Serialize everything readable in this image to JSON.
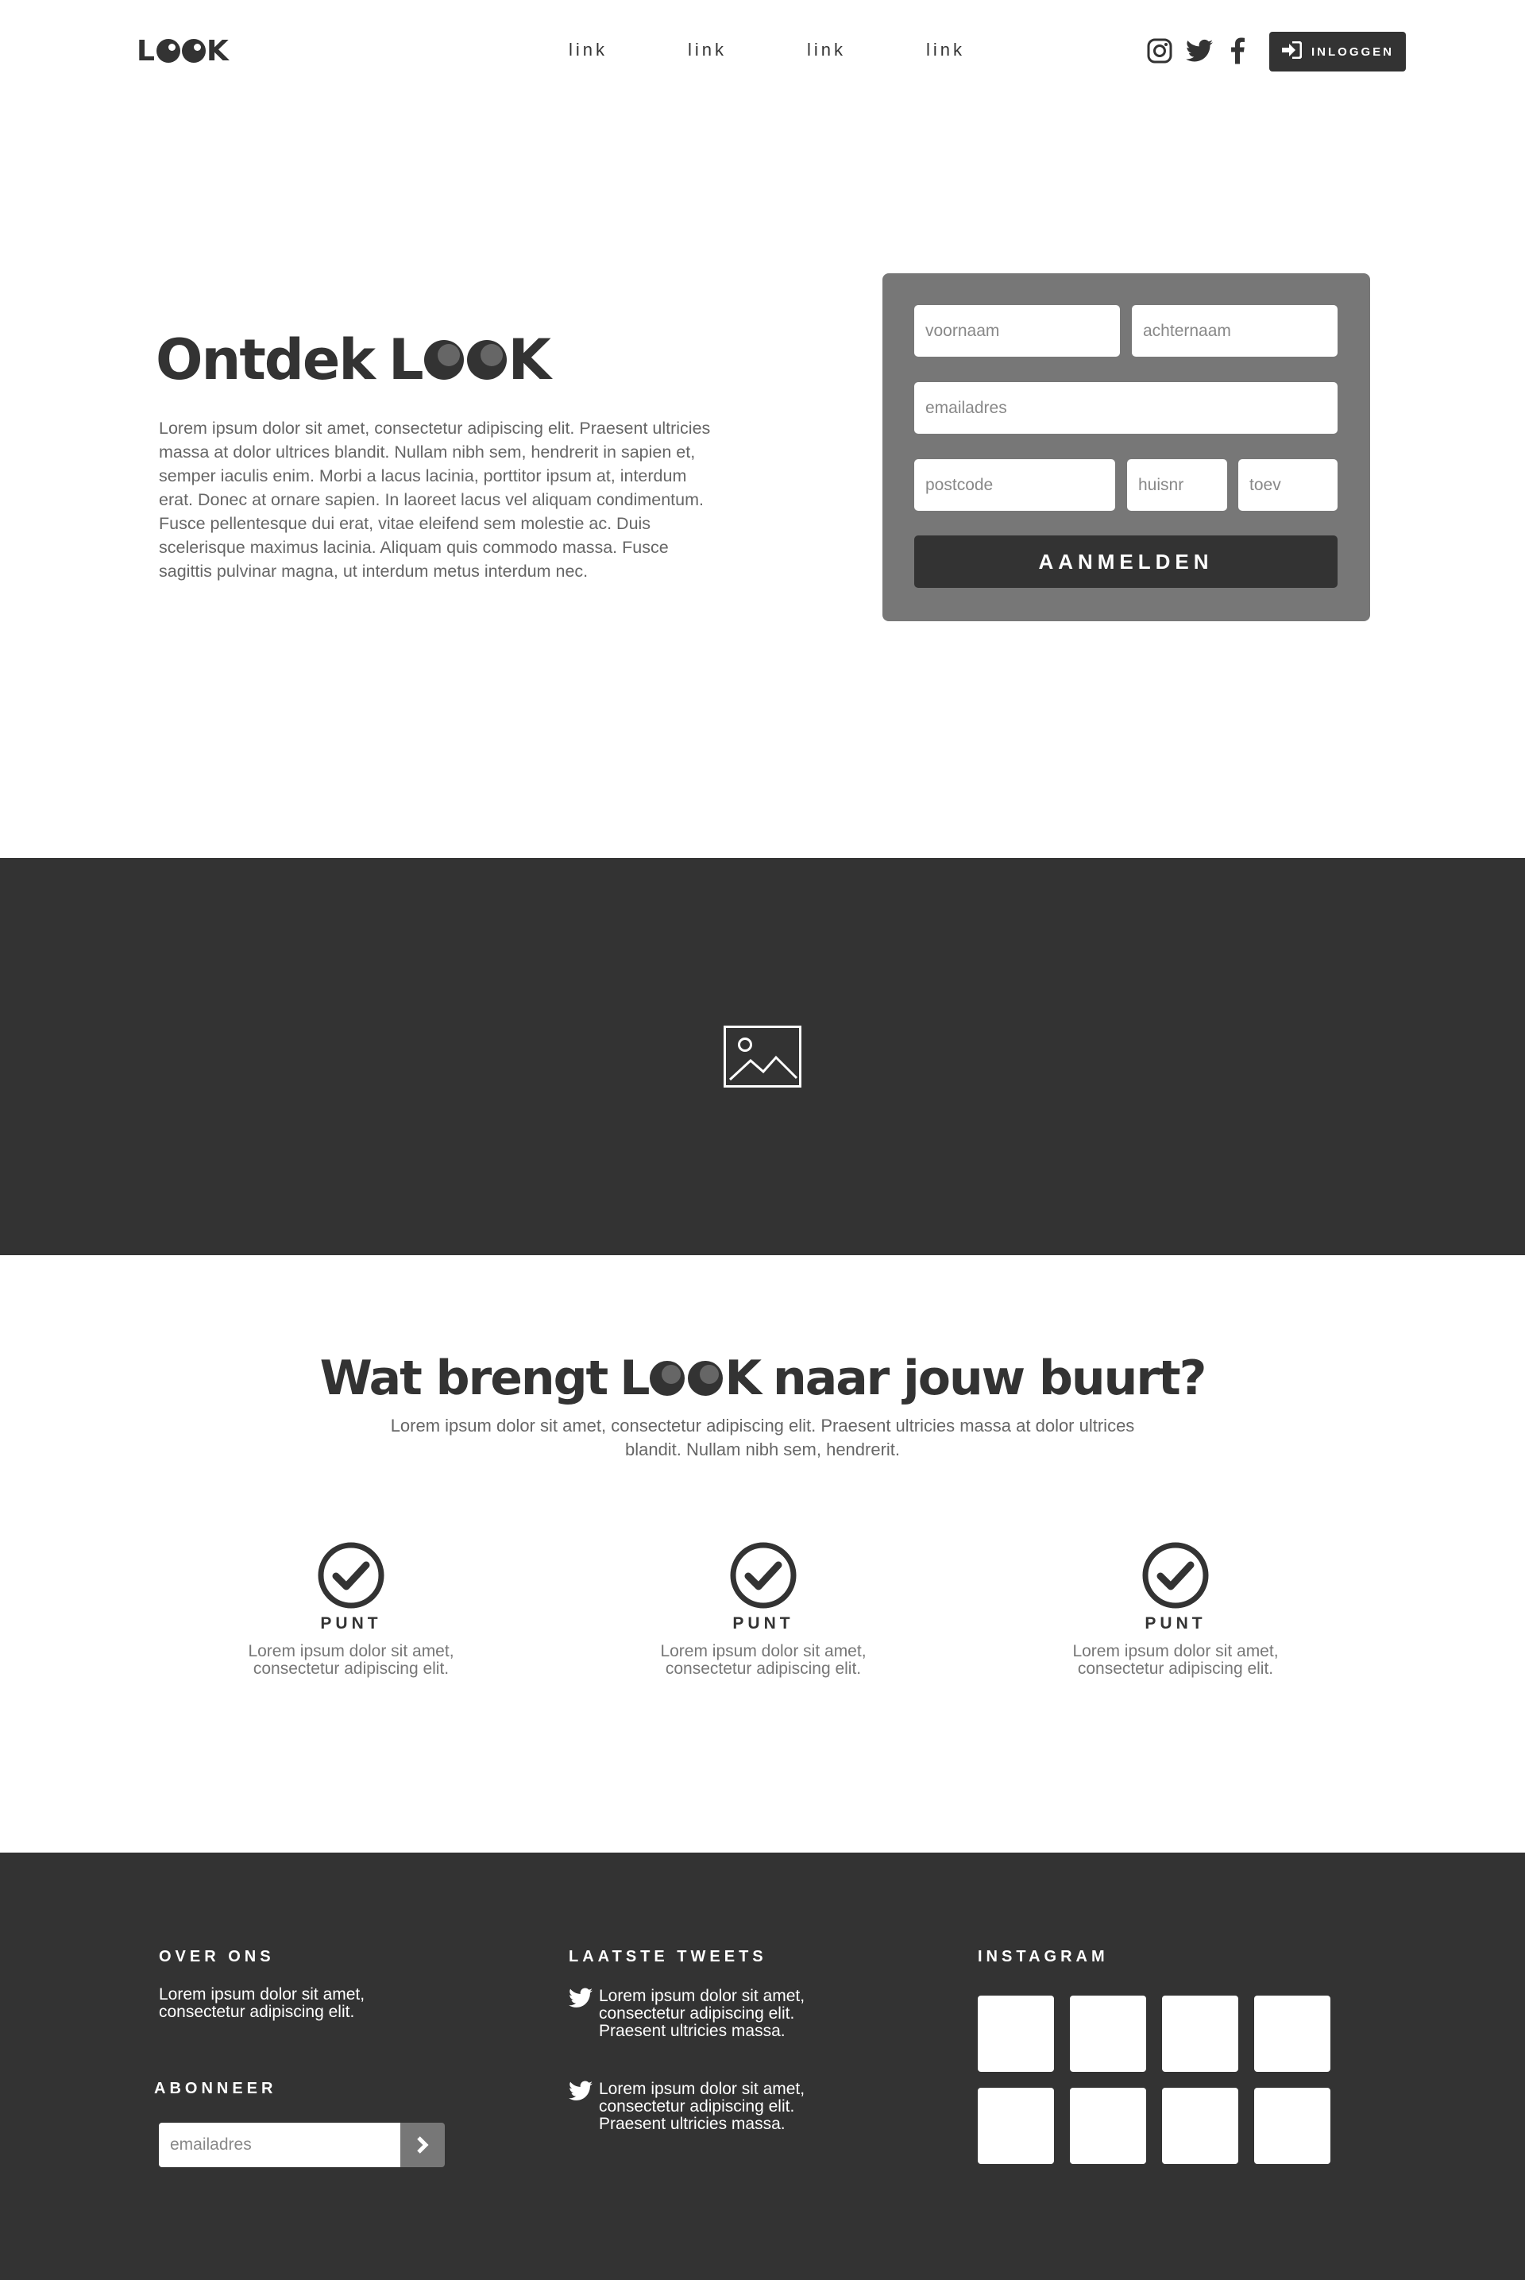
{
  "header": {
    "logo": {
      "first": "L",
      "last": "K"
    },
    "nav": [
      {
        "label": "link"
      },
      {
        "label": "link"
      },
      {
        "label": "link"
      },
      {
        "label": "link"
      }
    ],
    "social_icons": [
      "instagram-icon",
      "twitter-icon",
      "facebook-icon"
    ],
    "login_label": "INLOGGEN"
  },
  "hero": {
    "title_prefix": "Ontdek",
    "title_logo_first": "L",
    "title_logo_last": "K",
    "body": "Lorem ipsum dolor sit amet, consectetur adipiscing elit. Praesent ultricies massa at dolor ultrices blandit. Nullam nibh sem, hendrerit in sapien et, semper iaculis enim. Morbi a lacus lacinia, porttitor ipsum at, interdum erat. Donec at ornare sapien. In laoreet lacus vel aliquam condimentum. Fusce pellentesque dui erat, vitae eleifend sem molestie ac. Duis scelerisque maximus lacinia. Aliquam quis commodo massa. Fusce sagittis pulvinar magna, ut interdum metus interdum nec."
  },
  "signup_form": {
    "firstname_placeholder": "voornaam",
    "lastname_placeholder": "achternaam",
    "email_placeholder": "emailadres",
    "postcode_placeholder": "postcode",
    "housenumber_placeholder": "huisnr",
    "addition_placeholder": "toev",
    "submit_label": "AANMELDEN"
  },
  "image_band": {
    "icon": "image-placeholder-icon"
  },
  "features": {
    "title_before": "Wat brengt",
    "title_logo_first": "L",
    "title_logo_last": "K",
    "title_after": "naar jouw buurt?",
    "intro": "Lorem ipsum dolor sit amet, consectetur adipiscing elit. Praesent ultricies massa at dolor ultrices blandit. Nullam nibh sem, hendrerit.",
    "items": [
      {
        "icon": "check-circle-icon",
        "title": "PUNT",
        "text": "Lorem ipsum dolor sit amet, consectetur adipiscing elit."
      },
      {
        "icon": "check-circle-icon",
        "title": "PUNT",
        "text": "Lorem ipsum dolor sit amet, consectetur adipiscing elit."
      },
      {
        "icon": "check-circle-icon",
        "title": "PUNT",
        "text": "Lorem ipsum dolor sit amet, consectetur adipiscing elit."
      }
    ]
  },
  "footer": {
    "about_heading": "OVER ONS",
    "about_text": "Lorem ipsum dolor sit amet, consectetur adipiscing elit.",
    "subscribe_heading": "ABONNEER",
    "subscribe_placeholder": "emailadres",
    "tweets_heading": "LAATSTE TWEETS",
    "tweets": [
      {
        "text": "Lorem ipsum dolor sit amet, consectetur adipiscing elit. Praesent ultricies massa."
      },
      {
        "text": "Lorem ipsum dolor sit amet, consectetur adipiscing elit. Praesent ultricies massa."
      }
    ],
    "instagram_heading": "INSTAGRAM",
    "instagram_tiles": 8
  },
  "colors": {
    "dark": "#333333",
    "form_bg": "#777777",
    "text_muted": "#666666",
    "white": "#ffffff"
  }
}
